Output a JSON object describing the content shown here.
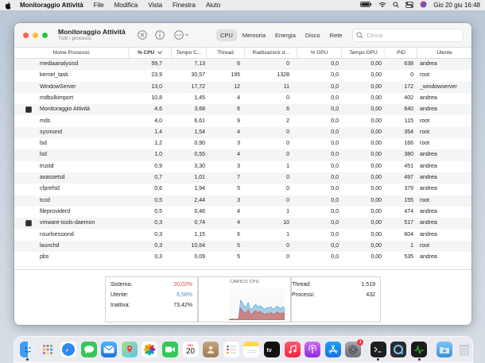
{
  "menubar": {
    "app_name": "Monitoraggio Attività",
    "items": [
      "File",
      "Modifica",
      "Vista",
      "Finestra",
      "Aiuto"
    ],
    "datetime": "Gio 20 giu  16:48"
  },
  "window": {
    "title": "Monitoraggio Attività",
    "subtitle": "Tutti i processi",
    "tabs": [
      "CPU",
      "Memoria",
      "Energia",
      "Disco",
      "Rete"
    ],
    "active_tab": "CPU",
    "search_placeholder": "Cerca"
  },
  "table": {
    "columns": [
      "Nome Processo",
      "% CPU",
      "Tempo C...",
      "Thread",
      "Riattivazioni d...",
      "% GPU",
      "Tempo GPU",
      "PID",
      "Utente"
    ],
    "sorted_column": "% CPU",
    "rows": [
      {
        "name": "mediaanalysisd",
        "cpu": "59,7",
        "time": "7,13",
        "threads": "6",
        "wakeups": "0",
        "gpu": "0,0",
        "gpu_time": "0,00",
        "pid": "638",
        "user": "andrea",
        "icon": false
      },
      {
        "name": "kernel_task",
        "cpu": "23,9",
        "time": "30,57",
        "threads": "195",
        "wakeups": "1328",
        "gpu": "0,0",
        "gpu_time": "0,00",
        "pid": "0",
        "user": "root",
        "icon": false
      },
      {
        "name": "WindowServer",
        "cpu": "13,0",
        "time": "17,72",
        "threads": "12",
        "wakeups": "11",
        "gpu": "0,0",
        "gpu_time": "0,00",
        "pid": "172",
        "user": "_windowserver",
        "icon": false
      },
      {
        "name": "mdbulkimport",
        "cpu": "10,8",
        "time": "1,45",
        "threads": "4",
        "wakeups": "0",
        "gpu": "0,0",
        "gpu_time": "0,00",
        "pid": "402",
        "user": "andrea",
        "icon": false
      },
      {
        "name": "Monitoraggio Attività",
        "cpu": "4,6",
        "time": "3,68",
        "threads": "6",
        "wakeups": "6",
        "gpu": "0,0",
        "gpu_time": "0,00",
        "pid": "640",
        "user": "andrea",
        "icon": true
      },
      {
        "name": "mds",
        "cpu": "4,0",
        "time": "6,61",
        "threads": "9",
        "wakeups": "2",
        "gpu": "0,0",
        "gpu_time": "0,00",
        "pid": "115",
        "user": "root",
        "icon": false
      },
      {
        "name": "sysmond",
        "cpu": "1,4",
        "time": "1,54",
        "threads": "4",
        "wakeups": "0",
        "gpu": "0,0",
        "gpu_time": "0,00",
        "pid": "354",
        "user": "root",
        "icon": false
      },
      {
        "name": "lsd",
        "cpu": "1,2",
        "time": "0,90",
        "threads": "3",
        "wakeups": "0",
        "gpu": "0,0",
        "gpu_time": "0,00",
        "pid": "166",
        "user": "root",
        "icon": false
      },
      {
        "name": "lsd",
        "cpu": "1,0",
        "time": "0,55",
        "threads": "4",
        "wakeups": "0",
        "gpu": "0,0",
        "gpu_time": "0,00",
        "pid": "380",
        "user": "andrea",
        "icon": false
      },
      {
        "name": "trustd",
        "cpu": "0,9",
        "time": "3,30",
        "threads": "3",
        "wakeups": "1",
        "gpu": "0,0",
        "gpu_time": "0,00",
        "pid": "451",
        "user": "andrea",
        "icon": false
      },
      {
        "name": "axassetsd",
        "cpu": "0,7",
        "time": "1,01",
        "threads": "7",
        "wakeups": "0",
        "gpu": "0,0",
        "gpu_time": "0,00",
        "pid": "497",
        "user": "andrea",
        "icon": false
      },
      {
        "name": "cfprefsd",
        "cpu": "0,6",
        "time": "1,94",
        "threads": "5",
        "wakeups": "0",
        "gpu": "0,0",
        "gpu_time": "0,00",
        "pid": "379",
        "user": "andrea",
        "icon": false
      },
      {
        "name": "tccd",
        "cpu": "0,5",
        "time": "2,44",
        "threads": "3",
        "wakeups": "0",
        "gpu": "0,0",
        "gpu_time": "0,00",
        "pid": "155",
        "user": "root",
        "icon": false
      },
      {
        "name": "fileproviderd",
        "cpu": "0,5",
        "time": "0,46",
        "threads": "4",
        "wakeups": "1",
        "gpu": "0,0",
        "gpu_time": "0,00",
        "pid": "474",
        "user": "andrea",
        "icon": false
      },
      {
        "name": "vmware-tools-daemon",
        "cpu": "0,3",
        "time": "0,74",
        "threads": "4",
        "wakeups": "10",
        "gpu": "0,0",
        "gpu_time": "0,00",
        "pid": "517",
        "user": "andrea",
        "icon": true
      },
      {
        "name": "nsurlsessiond",
        "cpu": "0,3",
        "time": "1,15",
        "threads": "6",
        "wakeups": "1",
        "gpu": "0,0",
        "gpu_time": "0,00",
        "pid": "604",
        "user": "andrea",
        "icon": false
      },
      {
        "name": "launchd",
        "cpu": "0,3",
        "time": "10,64",
        "threads": "5",
        "wakeups": "0",
        "gpu": "0,0",
        "gpu_time": "0,00",
        "pid": "1",
        "user": "root",
        "icon": false
      },
      {
        "name": "pbs",
        "cpu": "0,3",
        "time": "0,09",
        "threads": "5",
        "wakeups": "0",
        "gpu": "0,0",
        "gpu_time": "0,00",
        "pid": "535",
        "user": "andrea",
        "icon": false
      }
    ]
  },
  "stats": {
    "sistema_label": "Sistema:",
    "sistema_value": "20,02%",
    "utente_label": "Utente:",
    "utente_value": "6,56%",
    "inattiva_label": "Inattiva:",
    "inattiva_value": "73,42%",
    "chart_title": "CARICO CPU",
    "thread_label": "Thread:",
    "thread_value": "1.519",
    "processi_label": "Processi:",
    "processi_value": "432"
  },
  "colors": {
    "system": "#e34a3a",
    "user": "#3b9bd9",
    "accent": "#1a73e8"
  },
  "cpu_load": {
    "system": [
      2,
      2,
      3,
      2,
      2,
      3,
      38,
      30,
      24,
      22,
      34,
      20,
      18,
      26,
      30,
      22,
      28,
      24,
      20,
      18,
      22,
      20,
      24,
      18,
      20,
      26,
      22,
      20,
      24,
      20
    ],
    "user": [
      2,
      3,
      4,
      3,
      3,
      4,
      62,
      54,
      44,
      40,
      56,
      36,
      34,
      44,
      50,
      40,
      46,
      42,
      36,
      34,
      40,
      38,
      42,
      34,
      38,
      44,
      40,
      36,
      42,
      38
    ]
  },
  "dock": {
    "icons": [
      "finder-icon",
      "launchpad-icon",
      "safari-icon",
      "messages-icon",
      "mail-icon",
      "maps-icon",
      "photos-icon",
      "facetime-icon",
      "calendar-icon",
      "contacts-icon",
      "reminders-icon",
      "notes-icon",
      "appletv-icon",
      "music-icon",
      "podcasts-icon",
      "appstore-icon",
      "settings-icon",
      "terminal-icon",
      "quicktime-icon",
      "activity-monitor-icon",
      "downloads-folder-icon",
      "trash-icon"
    ],
    "calendar_day": "20",
    "calendar_month": "GIU",
    "settings_badge": "1"
  }
}
